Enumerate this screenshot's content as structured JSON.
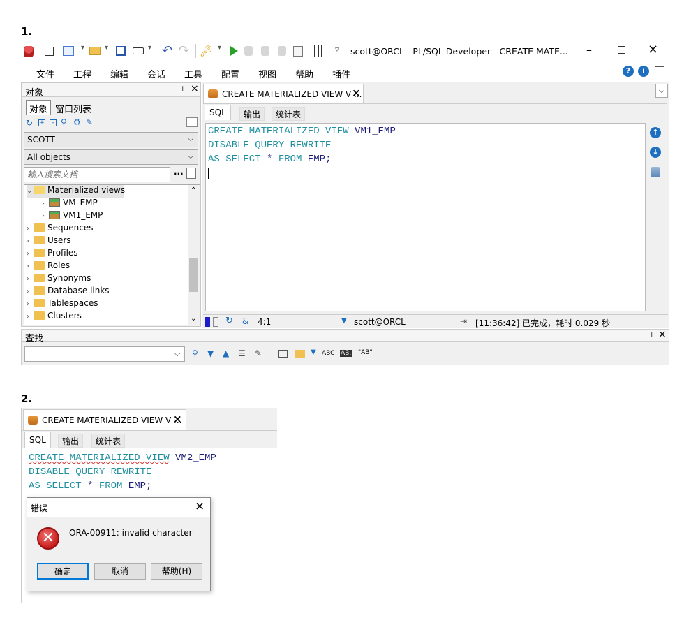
{
  "section1": {
    "number": "1.",
    "window_title": "scott@ORCL - PL/SQL Developer - CREATE MATE...",
    "menu": [
      "文件",
      "工程",
      "编辑",
      "会话",
      "工具",
      "配置",
      "视图",
      "帮助",
      "插件"
    ],
    "objects_panel": {
      "title": "对象",
      "tabs": [
        "对象",
        "窗口列表"
      ],
      "schema": "SCOTT",
      "filter": "All objects",
      "search_placeholder": "输入搜索文档",
      "tree": [
        {
          "label": "Materialized views",
          "type": "folder",
          "expanded": true
        },
        {
          "label": "VM_EMP",
          "type": "mview",
          "child": true
        },
        {
          "label": "VM1_EMP",
          "type": "mview",
          "child": true
        },
        {
          "label": "Sequences",
          "type": "folder"
        },
        {
          "label": "Users",
          "type": "folder"
        },
        {
          "label": "Profiles",
          "type": "folder"
        },
        {
          "label": "Roles",
          "type": "folder"
        },
        {
          "label": "Synonyms",
          "type": "folder"
        },
        {
          "label": "Database links",
          "type": "folder"
        },
        {
          "label": "Tablespaces",
          "type": "folder"
        },
        {
          "label": "Clusters",
          "type": "folder"
        }
      ]
    },
    "editor_tab": "CREATE MATERIALIZED VIEW V ...",
    "sub_tabs": [
      "SQL",
      "输出",
      "统计表"
    ],
    "sql": {
      "line1_kw": "CREATE MATERIALIZED VIEW",
      "line1_id": "VM1_EMP",
      "line2_kw": "DISABLE QUERY REWRITE",
      "line3_kw1": "AS SELECT",
      "line3_star": "*",
      "line3_kw2": "FROM",
      "line3_id": "EMP;"
    },
    "status": {
      "position": "4:1",
      "connection": "scott@ORCL",
      "message": "[11:36:42] 已完成，耗时 0.029 秒"
    },
    "find_bar": {
      "title": "查找",
      "abc1": "ABC",
      "abc2": "AB.",
      "abc3": "\"AB\""
    }
  },
  "section2": {
    "number": "2.",
    "editor_tab": "CREATE MATERIALIZED VIEW V ...",
    "sub_tabs": [
      "SQL",
      "输出",
      "统计表"
    ],
    "sql": {
      "line1_kw": "CREATE MATERIALIZED VIEW",
      "line1_id": "VM2_EMP",
      "line2_kw": "DISABLE QUERY REWRITE",
      "line3_kw1": "AS SELECT",
      "line3_star": "*",
      "line3_kw2": "FROM",
      "line3_id": "EMP;"
    },
    "dialog": {
      "title": "错误",
      "message": "ORA-00911: invalid character",
      "buttons": [
        "确定",
        "取消",
        "帮助(H)"
      ]
    }
  },
  "colors": {
    "keyword": "#1f8fa0",
    "identifier": "#1d1d7a",
    "error_red": "#d32f2f",
    "accent_blue": "#1e6fc0"
  }
}
